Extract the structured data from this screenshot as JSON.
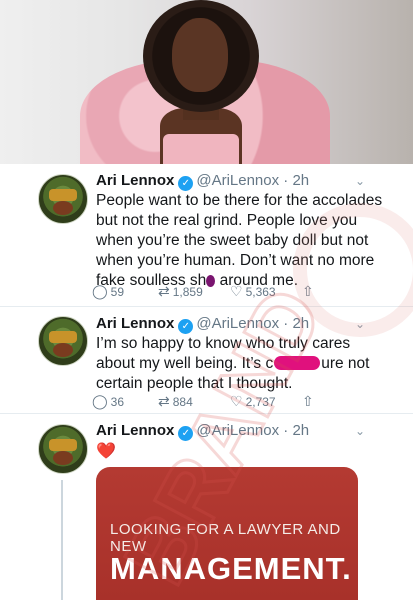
{
  "tweets": [
    {
      "name": "Ari Lennox",
      "handle": "@AriLennox",
      "dot": "·",
      "time": "2h",
      "lines": [
        "People want to be there for the accolades",
        "but not the real grind. People love you",
        "when you’re the sweet baby doll but not",
        "when you’re human. Don’t want no more"
      ],
      "last_pre": "fake soulless sh",
      "last_post": " around me.",
      "replies": "59",
      "retweets": "1,859",
      "likes": "5,363"
    },
    {
      "name": "Ari Lennox",
      "handle": "@AriLennox",
      "dot": "·",
      "time": "2h",
      "line1": "I’m so happy to know who truly cares",
      "line2_pre": "about my well being. It’s c",
      "line2_post": "ure not",
      "line3": "certain people that I thought.",
      "replies": "36",
      "retweets": "884",
      "likes": "2,737"
    },
    {
      "name": "Ari Lennox",
      "handle": "@AriLennox",
      "dot": "·",
      "time": "2h",
      "emoji": "❤️",
      "poster_line1": "LOOKING FOR A LAWYER AND NEW",
      "poster_line2": "MANAGEMENT."
    }
  ],
  "watermark": "BRAND",
  "icons": {
    "reply": "reply-icon",
    "retweet": "retweet-icon",
    "like": "heart-icon",
    "share": "share-icon",
    "verified": "verified-badge-icon",
    "menu": "chevron-down-icon"
  },
  "colors": {
    "verified": "#1da1f2",
    "poster_bg": "#b4372f",
    "heart": "#e0245e",
    "redaction": "#e0117d"
  }
}
